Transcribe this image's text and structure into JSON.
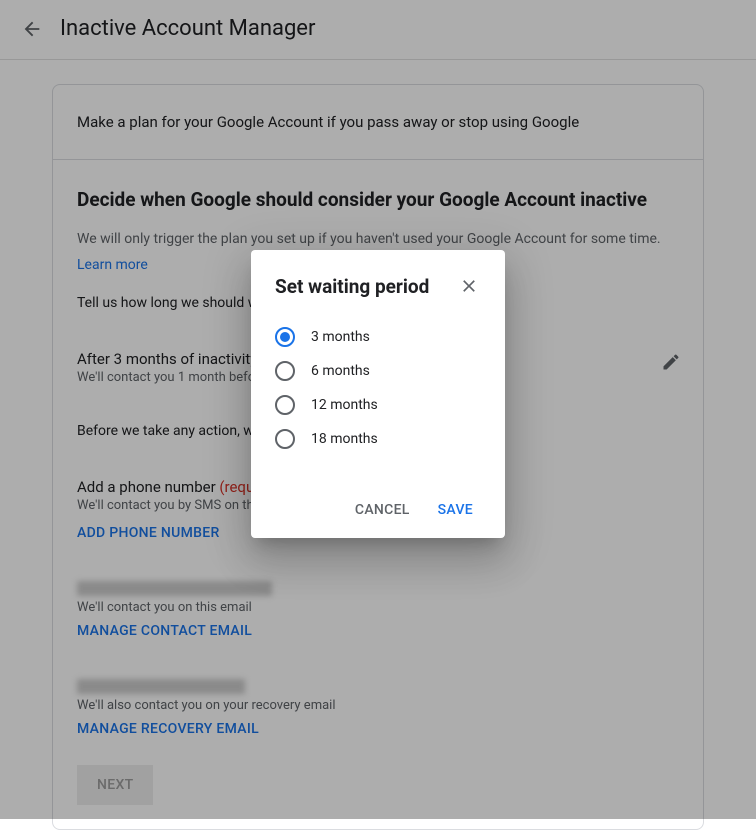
{
  "header": {
    "title": "Inactive Account Manager"
  },
  "intro": {
    "text": "Make a plan for your Google Account if you pass away or stop using Google"
  },
  "decide": {
    "title": "Decide when Google should consider your Google Account inactive",
    "body": "We will only trigger the plan you set up if you haven't used your Google Account for some time.",
    "learn_more": "Learn more",
    "tell_us": "Tell us how long we should wait."
  },
  "waiting": {
    "title": "After 3 months of inactivity",
    "sub": "We'll contact you 1 month before"
  },
  "before_action": "Before we take any action, we will contact you by SMS and email.",
  "phone": {
    "title_prefix": "Add a phone number ",
    "required": "(required)",
    "sub": "We'll contact you by SMS on this number",
    "action": "ADD PHONE NUMBER"
  },
  "email": {
    "sub": "We'll contact you on this email",
    "action": "MANAGE CONTACT EMAIL"
  },
  "recovery": {
    "sub": "We'll also contact you on your recovery email",
    "action": "MANAGE RECOVERY EMAIL"
  },
  "next": "NEXT",
  "dialog": {
    "title": "Set waiting period",
    "options": [
      "3 months",
      "6 months",
      "12 months",
      "18 months"
    ],
    "selected_index": 0,
    "cancel": "CANCEL",
    "save": "SAVE"
  }
}
